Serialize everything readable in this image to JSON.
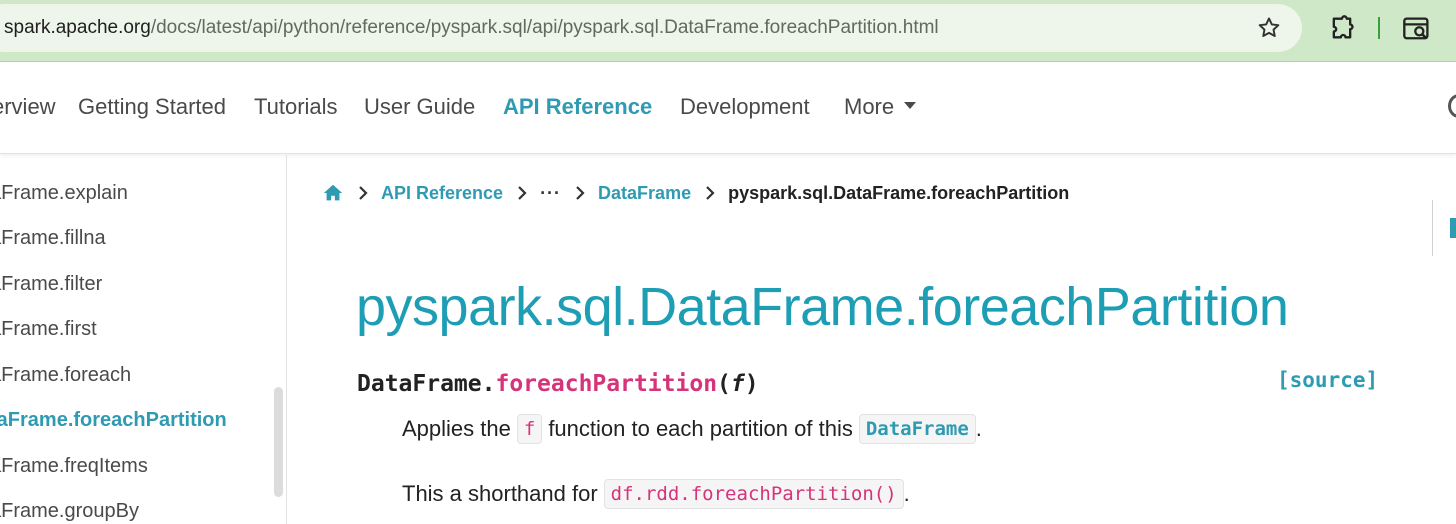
{
  "browser": {
    "url_host": "spark.apache.org",
    "url_path": "/docs/latest/api/python/reference/pyspark.sql/api/pyspark.sql.DataFrame.foreachPartition.html"
  },
  "navbar": {
    "items": [
      "erview",
      "Getting Started",
      "Tutorials",
      "User Guide",
      "API Reference",
      "Development"
    ],
    "more_label": "More",
    "active": "API Reference"
  },
  "sidebar": {
    "items": [
      "aFrame.explain",
      "aFrame.fillna",
      "aFrame.filter",
      "aFrame.first",
      "aFrame.foreach",
      "taFrame.foreachPartition",
      "aFrame.freqItems",
      "aFrame.groupBy"
    ],
    "active_index": 5
  },
  "breadcrumb": {
    "api_reference": "API Reference",
    "ellipsis": "···",
    "dataframe": "DataFrame",
    "current": "pyspark.sql.DataFrame.foreachPartition"
  },
  "title": "pyspark.sql.DataFrame.foreachPartition",
  "signature": {
    "class": "DataFrame.",
    "method": "foreachPartition",
    "open": "(",
    "param": "f",
    "close": ")",
    "source": "[source]"
  },
  "description": {
    "p1_before": "Applies the",
    "p1_code": "f",
    "p1_middle": "function to each partition of this",
    "p1_link": "DataFrame",
    "p1_after": ".",
    "p2_before": "This a shorthand for",
    "p2_code": "df.rdd.foreachPartition()",
    "p2_after": "."
  },
  "colors": {
    "accent": "#2f9bb2",
    "title": "#1d9eb4",
    "method": "#d6337a",
    "chrome": "#cfe8c8"
  },
  "icons": [
    "star-icon",
    "puzzle-extension-icon",
    "tab-search-icon",
    "home-icon",
    "chevron-right-icon",
    "caret-down-icon"
  ]
}
